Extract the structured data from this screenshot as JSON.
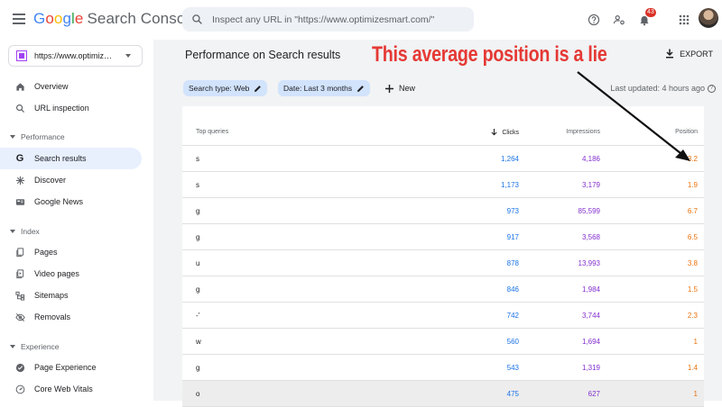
{
  "header": {
    "logo_google": "Google",
    "logo_product": "Search Console",
    "search_placeholder": "Inspect any URL in \"https://www.optimizesmart.com/\"",
    "notification_count": "43"
  },
  "sidebar": {
    "property": "https://www.optimiz…",
    "items_top": [
      {
        "label": "Overview",
        "icon": "home-icon"
      },
      {
        "label": "URL inspection",
        "icon": "search-icon"
      }
    ],
    "section_performance": "Performance",
    "items_performance": [
      {
        "label": "Search results",
        "icon": "google-g-icon"
      },
      {
        "label": "Discover",
        "icon": "discover-icon"
      },
      {
        "label": "Google News",
        "icon": "news-icon"
      }
    ],
    "section_index": "Index",
    "items_index": [
      {
        "label": "Pages",
        "icon": "pages-icon"
      },
      {
        "label": "Video pages",
        "icon": "video-pages-icon"
      },
      {
        "label": "Sitemaps",
        "icon": "sitemaps-icon"
      },
      {
        "label": "Removals",
        "icon": "removals-icon"
      }
    ],
    "section_experience": "Experience",
    "items_experience": [
      {
        "label": "Page Experience",
        "icon": "page-experience-icon"
      },
      {
        "label": "Core Web Vitals",
        "icon": "core-web-vitals-icon"
      }
    ]
  },
  "main": {
    "title": "Performance on Search results",
    "export_label": "EXPORT",
    "filters": [
      "Search type: Web",
      "Date: Last 3 months"
    ],
    "new_label": "New",
    "last_updated": "Last updated: 4 hours ago"
  },
  "table": {
    "headers": {
      "query": "Top queries",
      "clicks": "Clicks",
      "impressions": "Impressions",
      "position": "Position"
    },
    "rows": [
      {
        "query": "s",
        "clicks": "1,264",
        "impressions": "4,186",
        "position": "3.2"
      },
      {
        "query": "s",
        "clicks": "1,173",
        "impressions": "3,179",
        "position": "1.9"
      },
      {
        "query": "g",
        "clicks": "973",
        "impressions": "85,599",
        "position": "6.7"
      },
      {
        "query": "g",
        "clicks": "917",
        "impressions": "3,568",
        "position": "6.5"
      },
      {
        "query": "u",
        "clicks": "878",
        "impressions": "13,993",
        "position": "3.8"
      },
      {
        "query": "g",
        "clicks": "846",
        "impressions": "1,984",
        "position": "1.5"
      },
      {
        "query": "-'",
        "clicks": "742",
        "impressions": "3,744",
        "position": "2.3"
      },
      {
        "query": "w",
        "clicks": "560",
        "impressions": "1,694",
        "position": "1"
      },
      {
        "query": "g",
        "clicks": "543",
        "impressions": "1,319",
        "position": "1.4"
      },
      {
        "query": "o",
        "clicks": "475",
        "impressions": "627",
        "position": "1"
      }
    ]
  },
  "annotation": "This average position is a lie",
  "colors": {
    "clicks": "#1a73e8",
    "impressions": "#8430ce",
    "position": "#e8710a",
    "annotation": "#e53935",
    "accent": "#d2e3fc"
  }
}
